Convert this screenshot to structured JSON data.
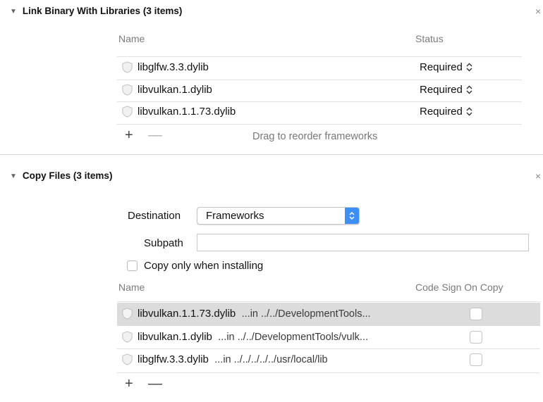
{
  "link_section": {
    "title": "Link Binary With Libraries (3 items)",
    "columns": {
      "name": "Name",
      "status": "Status"
    },
    "rows": [
      {
        "name": "libglfw.3.3.dylib",
        "status": "Required"
      },
      {
        "name": "libvulkan.1.dylib",
        "status": "Required"
      },
      {
        "name": "libvulkan.1.1.73.dylib",
        "status": "Required"
      }
    ],
    "add_label": "+",
    "remove_label": "—",
    "drag_hint": "Drag to reorder frameworks"
  },
  "copy_section": {
    "title": "Copy Files (3 items)",
    "destination_label": "Destination",
    "destination_value": "Frameworks",
    "subpath_label": "Subpath",
    "subpath_value": "",
    "copy_only_label": "Copy only when installing",
    "copy_only_checked": false,
    "columns": {
      "name": "Name",
      "code_sign": "Code Sign On Copy"
    },
    "rows": [
      {
        "name": "libvulkan.1.1.73.dylib",
        "path": "...in ../../DevelopmentTools...",
        "selected": true,
        "code_sign": false
      },
      {
        "name": "libvulkan.1.dylib",
        "path": "...in ../../DevelopmentTools/vulk...",
        "selected": false,
        "code_sign": false
      },
      {
        "name": "libglfw.3.3.dylib",
        "path": "...in ../../../../../usr/local/lib",
        "selected": false,
        "code_sign": false
      }
    ],
    "add_label": "+",
    "remove_label": "—"
  },
  "colors": {
    "accent": "#3d8ff6",
    "selection": "#dcdcdc"
  }
}
